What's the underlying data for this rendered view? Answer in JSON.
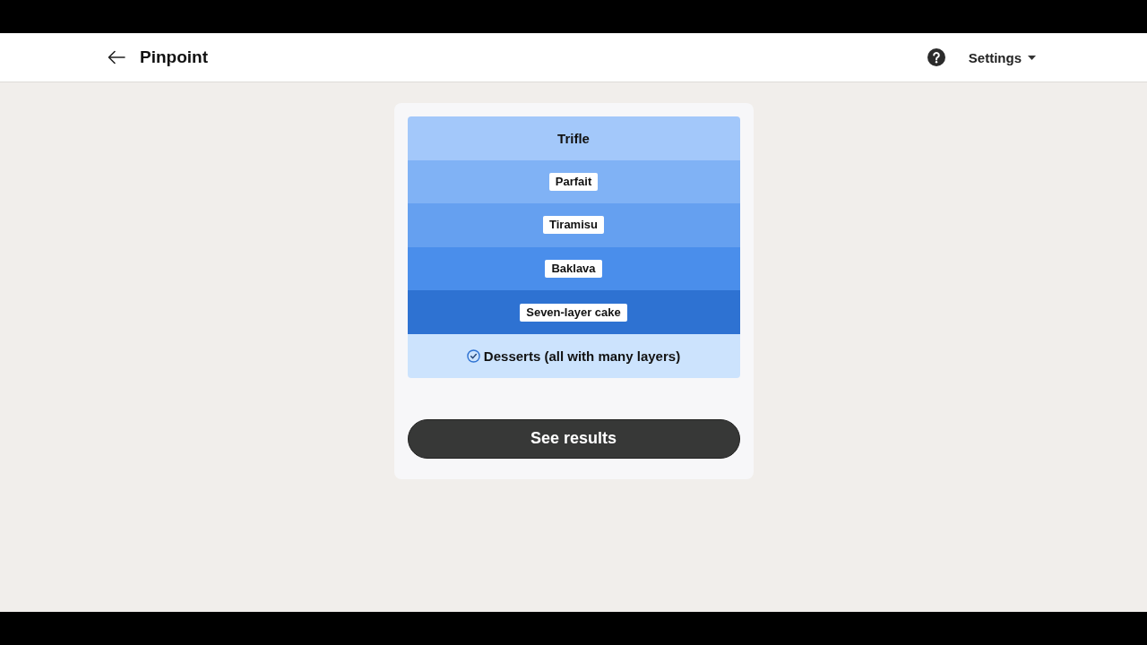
{
  "header": {
    "title": "Pinpoint",
    "settings": "Settings"
  },
  "layers": [
    {
      "label": "Trifle",
      "kind": "heading",
      "color": "#a3c8fa"
    },
    {
      "label": "Parfait",
      "kind": "chip",
      "color": "#80b2f5"
    },
    {
      "label": "Tiramisu",
      "kind": "chip",
      "color": "#65a0f0"
    },
    {
      "label": "Baklava",
      "kind": "chip",
      "color": "#4a8eeb"
    },
    {
      "label": "Seven-layer cake",
      "kind": "chip",
      "color": "#2e72d2"
    }
  ],
  "category": {
    "label": "Desserts (all with many layers)",
    "checked": true
  },
  "action": {
    "label": "See results"
  }
}
